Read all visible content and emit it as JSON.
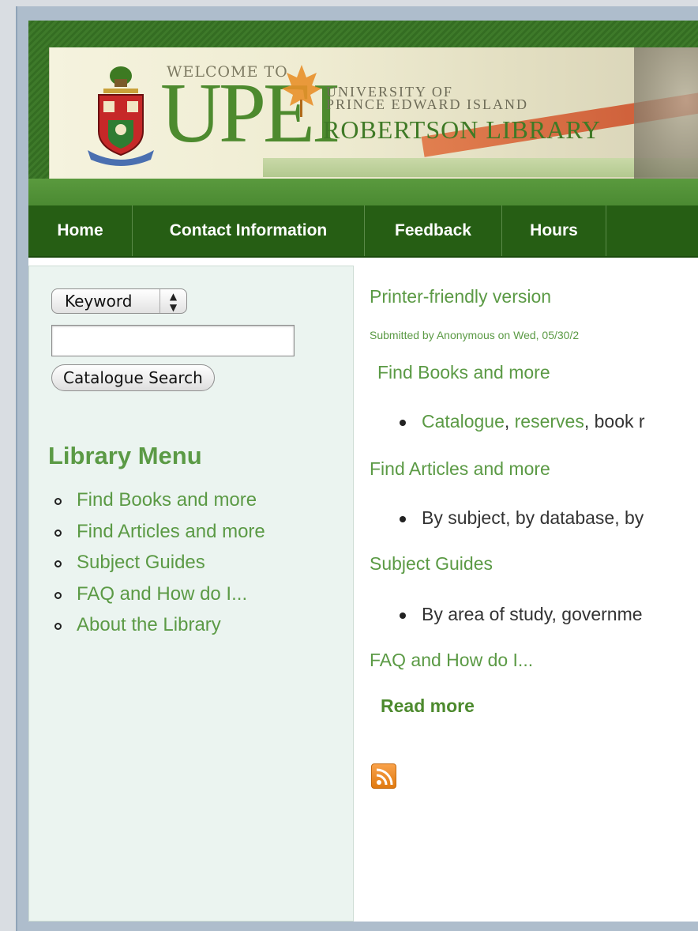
{
  "header": {
    "welcome": "WELCOME TO",
    "logo_text": "UPEI",
    "university_line1": "UNIVERSITY OF",
    "university_line2": "PRINCE EDWARD ISLAND",
    "library_name": "ROBERTSON LIBRARY"
  },
  "nav": {
    "items": [
      {
        "label": "Home"
      },
      {
        "label": "Contact Information"
      },
      {
        "label": "Feedback"
      },
      {
        "label": "Hours"
      }
    ]
  },
  "sidebar": {
    "search_type_selected": "Keyword",
    "search_input_value": "",
    "search_button_label": "Catalogue Search",
    "menu_title": "Library Menu",
    "menu_items": [
      {
        "label": "Find Books and more"
      },
      {
        "label": "Find Articles and more"
      },
      {
        "label": "Subject Guides"
      },
      {
        "label": "FAQ and How do I..."
      },
      {
        "label": "About the Library"
      }
    ]
  },
  "content": {
    "printer_friendly": "Printer-friendly version",
    "submitted": "Submitted by Anonymous on Wed, 05/30/2",
    "sections": [
      {
        "heading": "Find Books and more"
      },
      {
        "heading": "Find Articles and more"
      },
      {
        "heading": "Subject Guides"
      },
      {
        "heading": "FAQ and How do I..."
      }
    ],
    "books_bullet": {
      "link1": "Catalogue",
      "sep": ", ",
      "link2": "reserves",
      "rest": ", book r"
    },
    "articles_bullet": "By subject, by database, by",
    "guides_bullet": "By area of study, governme",
    "read_more": "Read more",
    "rss_icon": "rss-feed-icon"
  },
  "colors": {
    "nav_bg": "#265e14",
    "link_green": "#5b9a45",
    "sidebar_bg": "#ebf4f0"
  }
}
